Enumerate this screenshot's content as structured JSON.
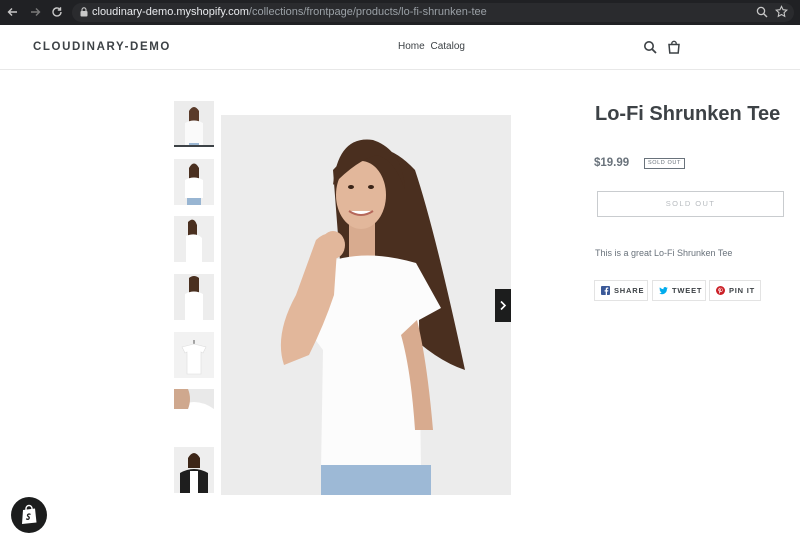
{
  "browser": {
    "url_host": "cloudinary-demo.myshopify.com",
    "url_path": "/collections/frontpage/products/lo-fi-shrunken-tee",
    "icons": [
      "back-arrow-icon",
      "forward-arrow-icon",
      "reload-icon",
      "lock-icon",
      "zoom-icon",
      "star-icon"
    ]
  },
  "header": {
    "logo": "CLOUDINARY-DEMO",
    "nav": [
      "Home",
      "Catalog"
    ],
    "icons": [
      "search-icon",
      "cart-icon"
    ]
  },
  "gallery": {
    "thumbnail_count": 7,
    "active_index": 0
  },
  "product": {
    "title": "Lo-Fi Shrunken Tee",
    "price": "$19.99",
    "badge": "SOLD OUT",
    "button": "SOLD OUT",
    "description": "This is a great Lo-Fi Shrunken Tee"
  },
  "share": [
    {
      "label": "SHARE",
      "icon": "facebook-icon",
      "color": "#3b5998"
    },
    {
      "label": "TWEET",
      "icon": "twitter-icon",
      "color": "#00aced"
    },
    {
      "label": "PIN IT",
      "icon": "pinterest-icon",
      "color": "#cb2027"
    }
  ],
  "colors": {
    "text": "#3d4246",
    "muted": "#69727b",
    "chrome": "#202124"
  }
}
